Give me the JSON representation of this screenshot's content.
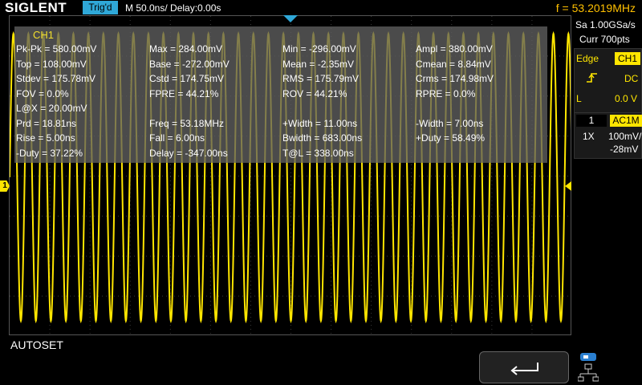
{
  "header": {
    "brand": "SIGLENT",
    "trigger_status": "Trig'd",
    "timebase": "M 50.0ns/  Delay:0.00s",
    "frequency": "f = 53.2019MHz"
  },
  "measure": {
    "channel": "CH1",
    "rows": [
      [
        "Pk-Pk = 580.00mV",
        "Max = 284.00mV",
        "Min = -296.00mV",
        "Ampl = 380.00mV"
      ],
      [
        "Top = 108.00mV",
        "Base = -272.00mV",
        "Mean = -2.35mV",
        "Cmean = 8.84mV"
      ],
      [
        "Stdev = 175.78mV",
        "Cstd = 174.75mV",
        "RMS = 175.79mV",
        "Crms = 174.98mV"
      ],
      [
        "FOV = 0.0%",
        "FPRE = 44.21%",
        "ROV = 44.21%",
        "RPRE = 0.0%"
      ],
      [
        "L@X = 20.00mV",
        "",
        "",
        ""
      ],
      [
        "Prd = 18.81ns",
        "Freq = 53.18MHz",
        "+Width = 11.00ns",
        "-Width = 7.00ns"
      ],
      [
        "Rise = 5.00ns",
        "Fall = 6.00ns",
        "Bwidth = 683.00ns",
        "+Duty = 58.49%"
      ],
      [
        "-Duty = 37.22%",
        "Delay = -347.00ns",
        "T@L = 338.00ns",
        ""
      ]
    ]
  },
  "acquisition": {
    "sample_rate": "Sa 1.00GSa/s",
    "memory": "Curr 700pts"
  },
  "trigger": {
    "type": "Edge",
    "source": "CH1",
    "coupling": "DC",
    "level_label": "L",
    "level_value": "0.0 V"
  },
  "channel": {
    "number": "1",
    "coupling": "AC1M",
    "probe": "1X",
    "scale": "100mV/",
    "offset": "-28mV",
    "marker": "1"
  },
  "footer": {
    "mode": "AUTOSET"
  },
  "waveform": {
    "color": "#ffe600",
    "cycles_on_screen": 37.5,
    "high_mv": 284,
    "low_mv": -296
  },
  "colors": {
    "trace": "#ffe600",
    "accent": "#2fa8d8",
    "frequency": "#ffc000"
  },
  "icons": {
    "back": "back-arrow-icon",
    "network": "network-icon",
    "trigger_edge": "rising-edge-icon"
  }
}
